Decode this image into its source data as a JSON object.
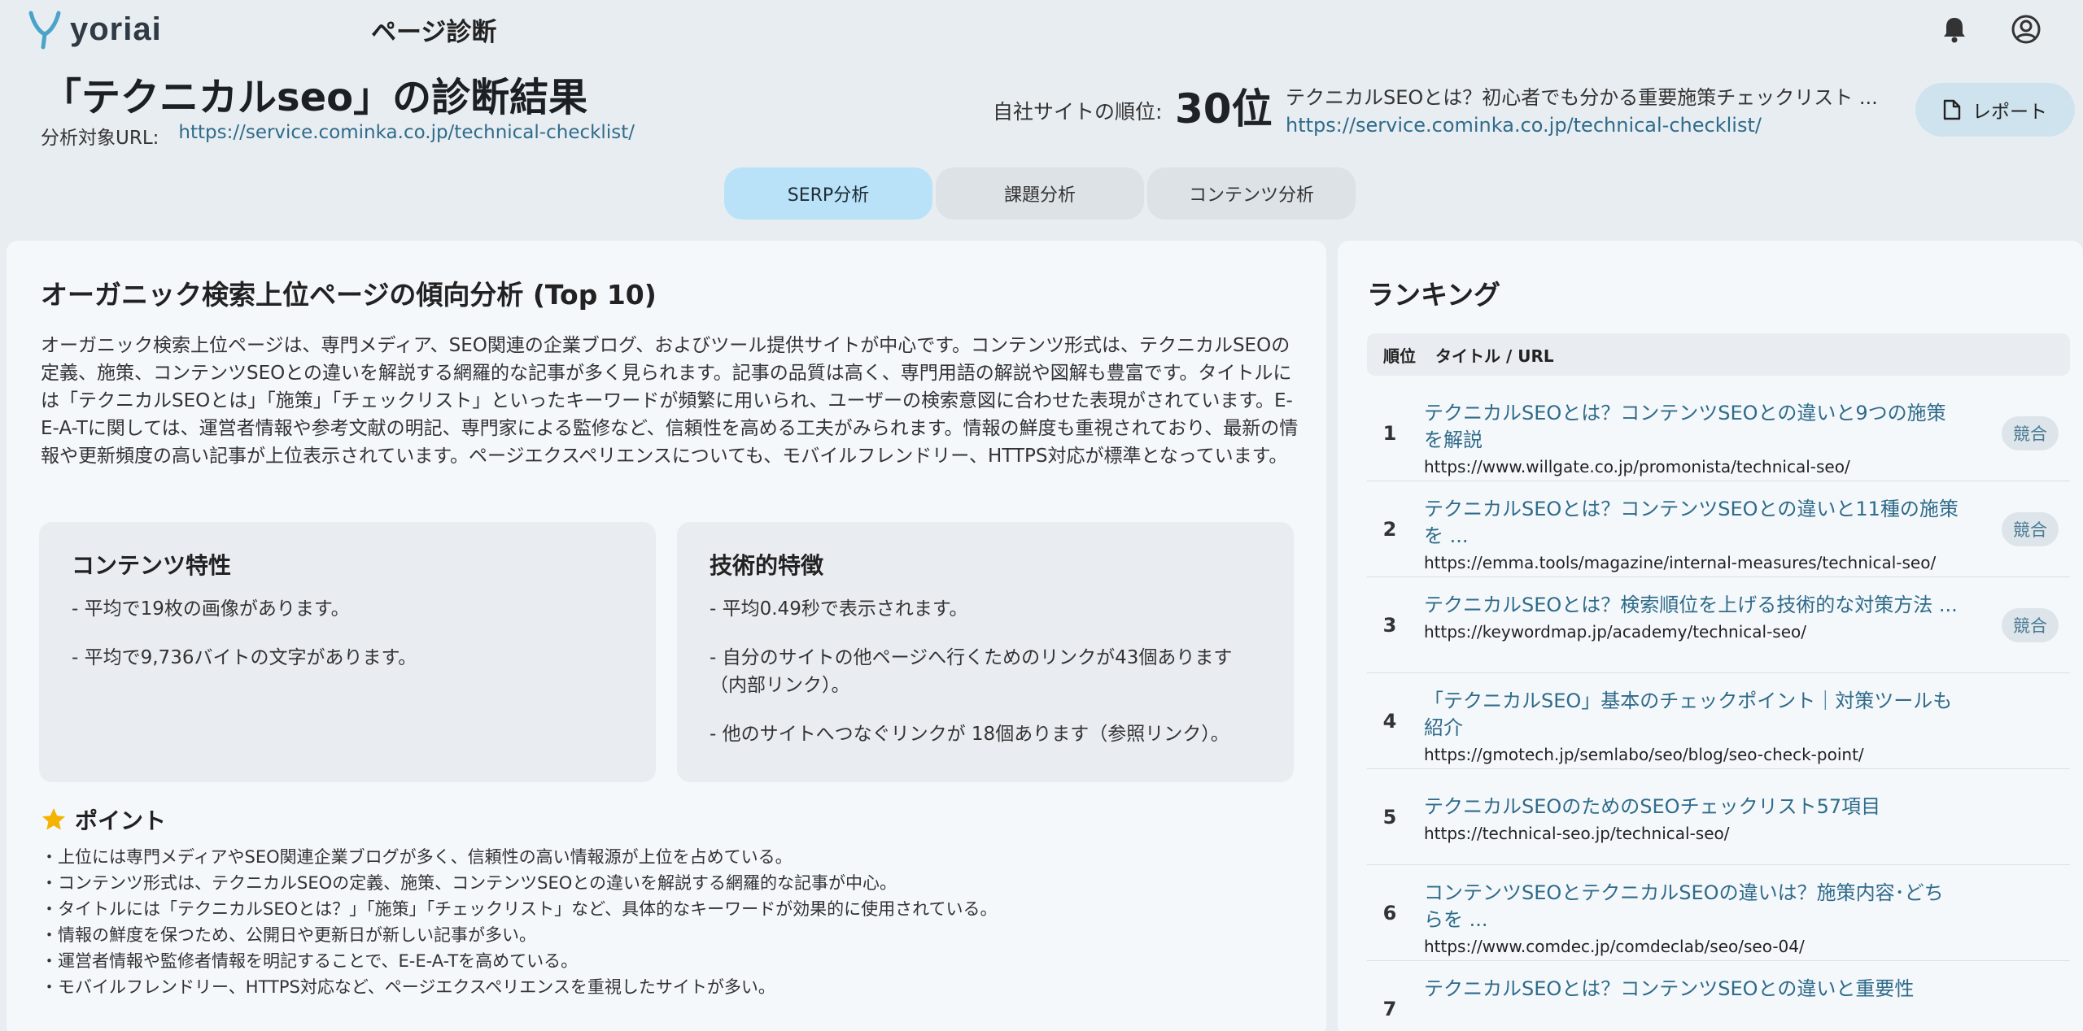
{
  "app": {
    "brand": "yoriai",
    "title": "ページ診断"
  },
  "colors": {
    "accent": "#2f6b8a",
    "tab_active": "#b9e2f8",
    "background": "#e8edf2"
  },
  "header": {
    "title": "「テクニカルseo」の診断結果",
    "url_label": "分析対象URL:",
    "url": "https://service.cominka.co.jp/technical-checklist/",
    "rank_label": "自社サイトの順位:",
    "rank_value": "30位",
    "rank_page_title": "テクニカルSEOとは？初心者でも分かる重要施策チェックリスト ...",
    "rank_page_url": "https://service.cominka.co.jp/technical-checklist/",
    "report_label": "レポート"
  },
  "tabs": [
    {
      "label": "SERP分析",
      "active": true
    },
    {
      "label": "課題分析",
      "active": false
    },
    {
      "label": "コンテンツ分析",
      "active": false
    }
  ],
  "analysis": {
    "heading": "オーガニック検索上位ページの傾向分析 (Top 10)",
    "summary": "オーガニック検索上位ページは、専門メディア、SEO関連の企業ブログ、およびツール提供サイトが中心です。コンテンツ形式は、テクニカルSEOの定義、施策、コンテンツSEOとの違いを解説する網羅的な記事が多く見られます。記事の品質は高く、専門用語の解説や図解も豊富です。タイトルには「テクニカルSEOとは」「施策」「チェックリスト」といったキーワードが頻繁に用いられ、ユーザーの検索意図に合わせた表現がされています。E-E-A-Tに関しては、運営者情報や参考文献の明記、専門家による監修など、信頼性を高める工夫がみられます。情報の鮮度も重視されており、最新の情報や更新頻度の高い記事が上位表示されています。ページエクスペリエンスについても、モバイルフレンドリー、HTTPS対応が標準となっています。",
    "content_card": {
      "title": "コンテンツ特性",
      "items": [
        "- 平均で19枚の画像があります。",
        "- 平均で9,736バイトの文字があります。"
      ]
    },
    "tech_card": {
      "title": "技術的特徴",
      "items": [
        "- 平均0.49秒で表示されます。",
        "- 自分のサイトの他ページへ行くためのリンクが43個あります（内部リンク）。",
        "- 他のサイトへつなぐリンクが 18個あります（参照リンク）。"
      ]
    },
    "point_title": "ポイント",
    "points": [
      "・上位には専門メディアやSEO関連企業ブログが多く、信頼性の高い情報源が上位を占めている。",
      "・コンテンツ形式は、テクニカルSEOの定義、施策、コンテンツSEOとの違いを解説する網羅的な記事が中心。",
      "・タイトルには「テクニカルSEOとは？」「施策」「チェックリスト」など、具体的なキーワードが効果的に使用されている。",
      "・情報の鮮度を保つため、公開日や更新日が新しい記事が多い。",
      "・運営者情報や監修者情報を明記することで、E-E-A-Tを高めている。",
      "・モバイルフレンドリー、HTTPS対応など、ページエクスペリエンスを重視したサイトが多い。"
    ]
  },
  "ranking": {
    "heading": "ランキング",
    "col_rank": "順位",
    "col_title": "タイトル / URL",
    "rows": [
      {
        "rank": "1",
        "title": "テクニカルSEOとは？コンテンツSEOとの違いと9つの施策を解説",
        "url": "https://www.willgate.co.jp/promonista/technical-seo/",
        "badge": "競合"
      },
      {
        "rank": "2",
        "title": "テクニカルSEOとは？コンテンツSEOとの違いと11種の施策を ...",
        "url": "https://emma.tools/magazine/internal-measures/technical-seo/",
        "badge": "競合"
      },
      {
        "rank": "3",
        "title": "テクニカルSEOとは？検索順位を上げる技術的な対策方法 ...",
        "url": "https://keywordmap.jp/academy/technical-seo/",
        "badge": "競合"
      },
      {
        "rank": "4",
        "title": "「テクニカルSEO」基本のチェックポイント｜対策ツールも紹介",
        "url": "https://gmotech.jp/semlabo/seo/blog/seo-check-point/",
        "badge": ""
      },
      {
        "rank": "5",
        "title": "テクニカルSEOのためのSEOチェックリスト57項目",
        "url": "https://technical-seo.jp/technical-seo/",
        "badge": ""
      },
      {
        "rank": "6",
        "title": "コンテンツSEOとテクニカルSEOの違いは？施策内容･どちらを ...",
        "url": "https://www.comdec.jp/comdeclab/seo/seo-04/",
        "badge": ""
      },
      {
        "rank": "7",
        "title": "テクニカルSEOとは？コンテンツSEOとの違いと重要性",
        "url": "",
        "badge": ""
      }
    ]
  }
}
